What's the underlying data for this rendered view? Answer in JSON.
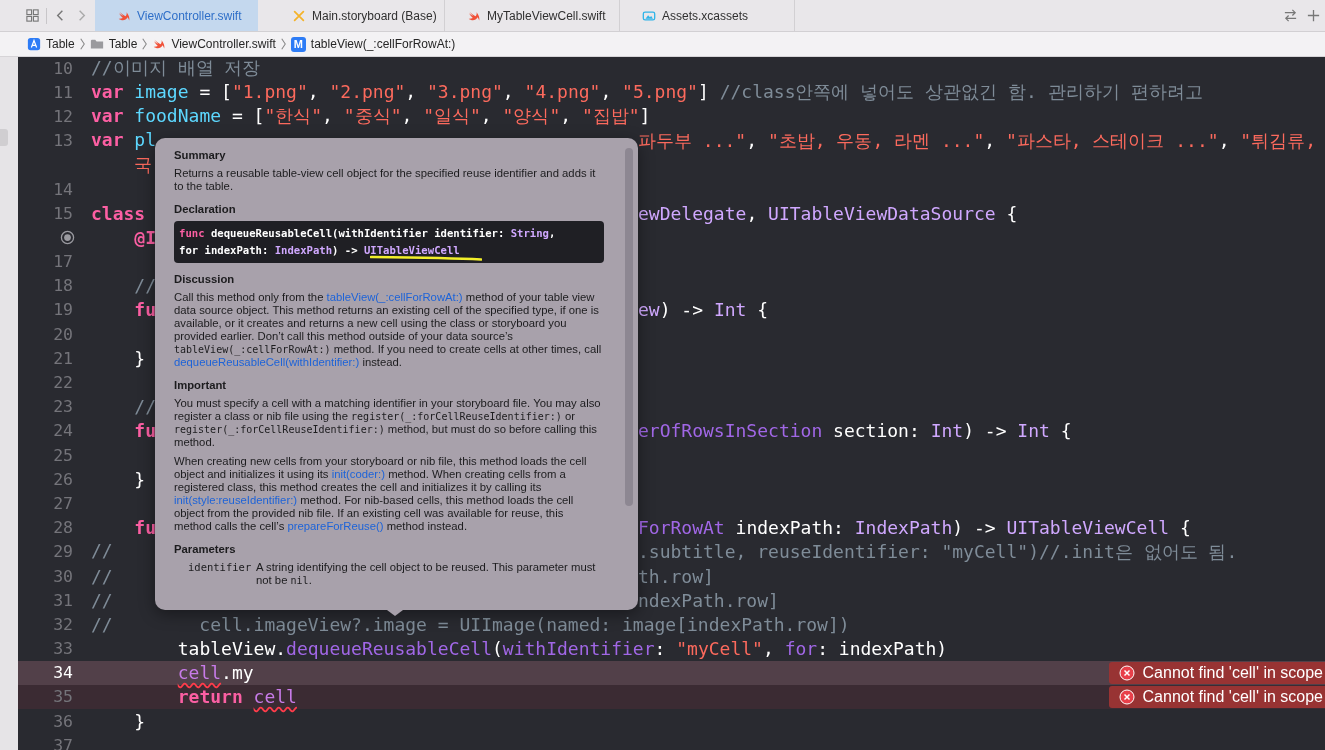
{
  "tabs": [
    {
      "label": "ViewController.swift",
      "kind": "swift",
      "selected": true
    },
    {
      "label": "Main.storyboard (Base)",
      "kind": "storyboard",
      "selected": false
    },
    {
      "label": "MyTableViewCell.swift",
      "kind": "swift",
      "selected": false
    },
    {
      "label": "Assets.xcassets",
      "kind": "assets",
      "selected": false
    }
  ],
  "breadcrumbs": [
    {
      "label": "Table",
      "kind": "project"
    },
    {
      "label": "Table",
      "kind": "folder"
    },
    {
      "label": "ViewController.swift",
      "kind": "swift"
    },
    {
      "label": "tableView(_:cellForRowAt:)",
      "kind": "method",
      "badge": "M"
    }
  ],
  "code_lines": [
    {
      "number": "10",
      "kind": "code",
      "current": false,
      "tokens": [
        {
          "text": "//이미지 배열 저장",
          "kind": "cmt"
        }
      ]
    },
    {
      "number": "11",
      "kind": "code",
      "current": false,
      "tokens": [
        {
          "text": "var",
          "kind": "kw"
        },
        {
          "text": " image",
          "kind": "decl"
        },
        {
          "text": " = [",
          "kind": "plain"
        },
        {
          "text": "\"1.png\"",
          "kind": "str"
        },
        {
          "text": ", ",
          "kind": "plain"
        },
        {
          "text": "\"2.png\"",
          "kind": "str"
        },
        {
          "text": ", ",
          "kind": "plain"
        },
        {
          "text": "\"3.png\"",
          "kind": "str"
        },
        {
          "text": ", ",
          "kind": "plain"
        },
        {
          "text": "\"4.png\"",
          "kind": "str"
        },
        {
          "text": ", ",
          "kind": "plain"
        },
        {
          "text": "\"5.png\"",
          "kind": "str"
        },
        {
          "text": "] ",
          "kind": "plain"
        },
        {
          "text": "//class안쪽에 넣어도 상관없긴 함. 관리하기 편하려고",
          "kind": "cmt"
        }
      ]
    },
    {
      "number": "12",
      "kind": "code",
      "current": false,
      "tokens": [
        {
          "text": "var",
          "kind": "kw"
        },
        {
          "text": " foodName",
          "kind": "decl"
        },
        {
          "text": " = [",
          "kind": "plain"
        },
        {
          "text": "\"한식\"",
          "kind": "str"
        },
        {
          "text": ", ",
          "kind": "plain"
        },
        {
          "text": "\"중식\"",
          "kind": "str"
        },
        {
          "text": ", ",
          "kind": "plain"
        },
        {
          "text": "\"일식\"",
          "kind": "str"
        },
        {
          "text": ", ",
          "kind": "plain"
        },
        {
          "text": "\"양식\"",
          "kind": "str"
        },
        {
          "text": ", ",
          "kind": "plain"
        },
        {
          "text": "\"집밥\"",
          "kind": "str"
        },
        {
          "text": "]",
          "kind": "plain"
        }
      ]
    },
    {
      "number": "13",
      "kind": "code",
      "current": false,
      "tokens": [
        {
          "text": "var",
          "kind": "kw"
        },
        {
          "text": " pl",
          "kind": "decl"
        }
      ],
      "tokens_after_popover": [
        {
          "text": "파두부 ...\"",
          "kind": "str"
        },
        {
          "text": ", ",
          "kind": "plain"
        },
        {
          "text": "\"초밥, 우동, 라멘 ...\"",
          "kind": "str"
        },
        {
          "text": ", ",
          "kind": "plain"
        },
        {
          "text": "\"파스타, 스테이크 ...\"",
          "kind": "str"
        },
        {
          "text": ", ",
          "kind": "plain"
        },
        {
          "text": "\"튀김류,",
          "kind": "str"
        }
      ]
    },
    {
      "kind": "wrap",
      "current": false,
      "tokens": [
        {
          "text": "    국",
          "kind": "str"
        }
      ]
    },
    {
      "number": "14",
      "kind": "code",
      "current": false
    },
    {
      "number": "15",
      "kind": "code",
      "current": false,
      "tokens": [
        {
          "text": "class",
          "kind": "kw"
        }
      ],
      "tokens_after_popover": [
        {
          "text": "ewDelegate",
          "kind": "type"
        },
        {
          "text": ", ",
          "kind": "plain"
        },
        {
          "text": "UITableViewDataSource",
          "kind": "type"
        },
        {
          "text": " {",
          "kind": "plain"
        }
      ]
    },
    {
      "kind": "outlet",
      "current": false,
      "tokens": [
        {
          "text": "    @I",
          "kind": "kw"
        }
      ]
    },
    {
      "number": "17",
      "kind": "code",
      "current": false
    },
    {
      "number": "18",
      "kind": "code",
      "current": false,
      "tokens": [
        {
          "text": "    //",
          "kind": "cmt"
        }
      ]
    },
    {
      "number": "19",
      "kind": "code",
      "current": false,
      "tokens": [
        {
          "text": "    fu",
          "kind": "kw"
        }
      ],
      "tokens_after_popover": [
        {
          "text": "ew",
          "kind": "type"
        },
        {
          "text": ") -> ",
          "kind": "plain"
        },
        {
          "text": "Int",
          "kind": "type"
        },
        {
          "text": " {",
          "kind": "plain"
        }
      ]
    },
    {
      "number": "20",
      "kind": "code",
      "current": false
    },
    {
      "number": "21",
      "kind": "code",
      "current": false,
      "tokens": [
        {
          "text": "    }",
          "kind": "plain"
        }
      ]
    },
    {
      "number": "22",
      "kind": "code",
      "current": false
    },
    {
      "number": "23",
      "kind": "code",
      "current": false,
      "tokens": [
        {
          "text": "    //",
          "kind": "cmt"
        }
      ]
    },
    {
      "number": "24",
      "kind": "code",
      "current": false,
      "tokens": [
        {
          "text": "    fu",
          "kind": "kw"
        }
      ],
      "tokens_after_popover": [
        {
          "text": "erOfRowsInSection",
          "kind": "method"
        },
        {
          "text": " section: ",
          "kind": "plain"
        },
        {
          "text": "Int",
          "kind": "type"
        },
        {
          "text": ") -> ",
          "kind": "plain"
        },
        {
          "text": "Int",
          "kind": "type"
        },
        {
          "text": " {",
          "kind": "plain"
        }
      ]
    },
    {
      "number": "25",
      "kind": "code",
      "current": false
    },
    {
      "number": "26",
      "kind": "code",
      "current": false,
      "tokens": [
        {
          "text": "    }",
          "kind": "plain"
        }
      ]
    },
    {
      "number": "27",
      "kind": "code",
      "current": false
    },
    {
      "number": "28",
      "kind": "code",
      "current": false,
      "tokens": [
        {
          "text": "    fu",
          "kind": "kw"
        }
      ],
      "tokens_after_popover": [
        {
          "text": "ForRowAt",
          "kind": "method"
        },
        {
          "text": " indexPath: ",
          "kind": "plain"
        },
        {
          "text": "IndexPath",
          "kind": "type"
        },
        {
          "text": ") -> ",
          "kind": "plain"
        },
        {
          "text": "UITableViewCell",
          "kind": "type"
        },
        {
          "text": " {",
          "kind": "plain"
        }
      ]
    },
    {
      "number": "29",
      "kind": "code",
      "current": false,
      "tokens": [
        {
          "text": "//",
          "kind": "cmt"
        }
      ],
      "tokens_after_popover": [
        {
          "text": ".subtitle, reuseIdentifier: \"myCell\")//.init은 없어도 됨.",
          "kind": "cmt"
        }
      ]
    },
    {
      "number": "30",
      "kind": "code",
      "current": false,
      "tokens": [
        {
          "text": "//",
          "kind": "cmt"
        }
      ],
      "tokens_after_popover": [
        {
          "text": "th.row]",
          "kind": "cmt"
        }
      ]
    },
    {
      "number": "31",
      "kind": "code",
      "current": false,
      "tokens": [
        {
          "text": "//",
          "kind": "cmt"
        }
      ],
      "tokens_after_popover": [
        {
          "text": "ndexPath.row]",
          "kind": "cmt"
        }
      ]
    },
    {
      "number": "32",
      "kind": "code",
      "current": false,
      "tokens": [
        {
          "text": "//        cell.imageView?.image = UIImage(named: image[indexPath.row])",
          "kind": "cmt"
        }
      ]
    },
    {
      "number": "33",
      "kind": "code",
      "current": false,
      "tokens": [
        {
          "text": "        tableView.",
          "kind": "plain"
        },
        {
          "text": "dequeueReusableCell",
          "kind": "method"
        },
        {
          "text": "(",
          "kind": "plain"
        },
        {
          "text": "withIdentifier",
          "kind": "method"
        },
        {
          "text": ": ",
          "kind": "plain"
        },
        {
          "text": "\"myCell\"",
          "kind": "str"
        },
        {
          "text": ", ",
          "kind": "plain"
        },
        {
          "text": "for",
          "kind": "method"
        },
        {
          "text": ": indexPath)",
          "kind": "plain"
        }
      ]
    },
    {
      "number": "34",
      "kind": "code",
      "current": true,
      "tokens": [
        {
          "text": "        cell",
          "kind": "errref"
        },
        {
          "text": ".my",
          "kind": "plain"
        }
      ],
      "error": "Cannot find 'cell' in scope"
    },
    {
      "number": "35",
      "kind": "code",
      "current": false,
      "tokens": [
        {
          "text": "        return",
          "kind": "kw"
        },
        {
          "text": " cell",
          "kind": "errref"
        }
      ],
      "error": "Cannot find 'cell' in scope"
    },
    {
      "number": "36",
      "kind": "code",
      "current": false,
      "tokens": [
        {
          "text": "    }",
          "kind": "plain"
        }
      ]
    },
    {
      "number": "37",
      "kind": "code",
      "current": false
    }
  ],
  "popover": {
    "sections": [
      {
        "kind": "text",
        "heading": "Summary",
        "paragraphs": [
          [
            {
              "text": "Returns a reusable table-view cell object for the specified reuse identifier and adds it to the table.",
              "kind": "text"
            }
          ]
        ]
      },
      {
        "kind": "declaration",
        "heading": "Declaration",
        "lines": [
          [
            {
              "text": "func",
              "kind": "kw"
            },
            {
              "text": " dequeueReusableCell(withIdentifier identifier: ",
              "kind": "plain"
            },
            {
              "text": "String",
              "kind": "type"
            },
            {
              "text": ",",
              "kind": "plain"
            }
          ],
          [
            {
              "text": "for indexPath: ",
              "kind": "plain"
            },
            {
              "text": "IndexPath",
              "kind": "type"
            },
            {
              "text": ") -> ",
              "kind": "plain"
            },
            {
              "text": "UITableViewCell",
              "kind": "type"
            }
          ]
        ],
        "annotation": {
          "kind": "underline"
        }
      },
      {
        "kind": "text",
        "heading": "Discussion",
        "paragraphs": [
          [
            {
              "text": "Call this method only from the ",
              "kind": "text"
            },
            {
              "text": "tableView(_:cellForRowAt:)",
              "kind": "link"
            },
            {
              "text": " method of your table view data source object. This method returns an existing cell of the specified type, if one is available, or it creates and returns a new cell using the class or storyboard you provided earlier. Don’t call this method outside of your data source’s ",
              "kind": "text"
            },
            {
              "text": "tableView(_:cellForRowAt:)",
              "kind": "code"
            },
            {
              "text": " method. If you need to create cells at other times, call ",
              "kind": "text"
            },
            {
              "text": "dequeueReusableCell(withIdentifier:)",
              "kind": "link"
            },
            {
              "text": " instead.",
              "kind": "text"
            }
          ]
        ]
      },
      {
        "kind": "text",
        "heading": "Important",
        "paragraphs": [
          [
            {
              "text": "You must specify a cell with a matching identifier in your storyboard file. You may also register a class or nib file using the ",
              "kind": "text"
            },
            {
              "text": "register(_:forCellReuseIdentifier:)",
              "kind": "code"
            },
            {
              "text": " or ",
              "kind": "text"
            },
            {
              "text": "register(_:forCellReuseIdentifier:)",
              "kind": "code"
            },
            {
              "text": " method, but must do so before calling this method.",
              "kind": "text"
            }
          ],
          [
            {
              "text": "When creating new cells from your storyboard or nib file, this method loads the cell object and initializes it using its ",
              "kind": "text"
            },
            {
              "text": "init(coder:)",
              "kind": "link"
            },
            {
              "text": " method. When creating cells from a registered class, this method creates the cell and initializes it by calling its ",
              "kind": "text"
            },
            {
              "text": "init(style:reuseIdentifier:)",
              "kind": "link"
            },
            {
              "text": " method. For nib-based cells, this method loads the cell object from the provided nib file. If an existing cell was available for reuse, this method calls the cell’s ",
              "kind": "text"
            },
            {
              "text": "prepareForReuse()",
              "kind": "link"
            },
            {
              "text": " method instead.",
              "kind": "text"
            }
          ]
        ]
      },
      {
        "kind": "parameters",
        "heading": "Parameters",
        "items": [
          {
            "name": "identifier",
            "description": [
              {
                "text": "A string identifying the cell object to be reused. This parameter must not be ",
                "kind": "text"
              },
              {
                "text": "nil",
                "kind": "code"
              },
              {
                "text": ".",
                "kind": "text"
              }
            ]
          }
        ]
      }
    ]
  }
}
